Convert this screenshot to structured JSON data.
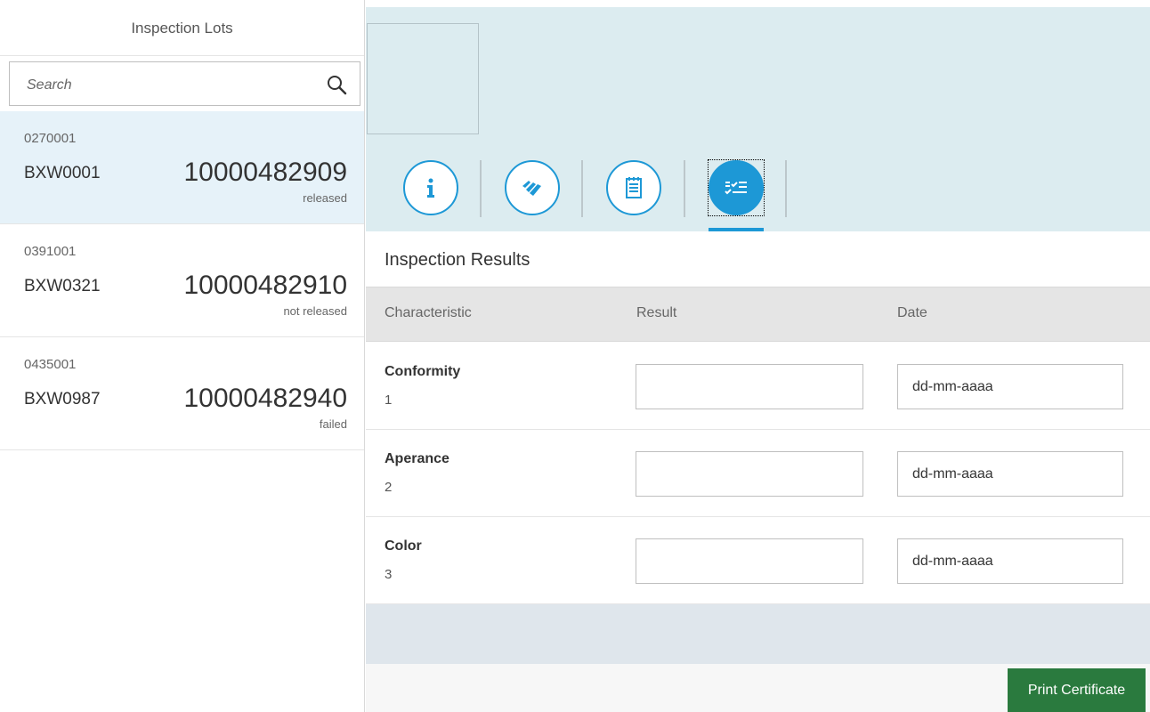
{
  "master": {
    "title": "Inspection Lots",
    "search_placeholder": "Search",
    "lots": [
      {
        "code": "0270001",
        "name": "BXW0001",
        "number": "10000482909",
        "status": "released"
      },
      {
        "code": "0391001",
        "name": "BXW0321",
        "number": "10000482910",
        "status": "not released"
      },
      {
        "code": "0435001",
        "name": "BXW0987",
        "number": "10000482940",
        "status": "failed"
      }
    ]
  },
  "detail": {
    "tabs": [
      {
        "icon": "info-icon"
      },
      {
        "icon": "stack-icon"
      },
      {
        "icon": "notepad-icon"
      },
      {
        "icon": "checklist-icon",
        "active": true
      }
    ],
    "section_title": "Inspection Results",
    "columns": {
      "characteristic": "Characteristic",
      "result": "Result",
      "date": "Date"
    },
    "rows": [
      {
        "name": "Conformity",
        "number": "1",
        "result": "",
        "date_placeholder": "dd-mm-aaaa"
      },
      {
        "name": "Aperance",
        "number": "2",
        "result": "",
        "date_placeholder": "dd-mm-aaaa"
      },
      {
        "name": "Color",
        "number": "3",
        "result": "",
        "date_placeholder": "dd-mm-aaaa"
      }
    ],
    "print_button": "Print Certificate"
  },
  "colors": {
    "accent": "#1d98d6",
    "header_bg": "#dcecf0",
    "selected_bg": "#e6f2f9",
    "print_button": "#2a7a3e"
  }
}
